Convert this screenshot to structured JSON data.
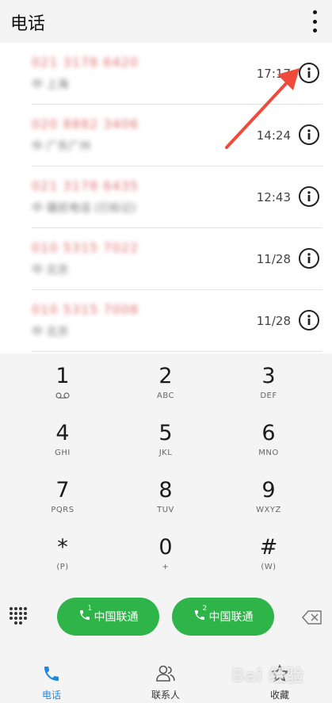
{
  "header": {
    "title": "电话",
    "more_icon": "more-vert-icon"
  },
  "calls": [
    {
      "number": "021 3178 6420",
      "location": "中 上海",
      "time": "17:17"
    },
    {
      "number": "020 8882 3406",
      "location": "中 广东广州",
      "time": "14:24"
    },
    {
      "number": "021 3178 6435",
      "location": "中 骚扰电话 (已标记)",
      "time": "12:43"
    },
    {
      "number": "010 5315 7022",
      "location": "中 北京",
      "time": "11/28"
    },
    {
      "number": "010 5315 7008",
      "location": "中 北京",
      "time": "11/28"
    }
  ],
  "keypad": [
    {
      "digit": "1",
      "letters": ""
    },
    {
      "digit": "2",
      "letters": "ABC"
    },
    {
      "digit": "3",
      "letters": "DEF"
    },
    {
      "digit": "4",
      "letters": "GHI"
    },
    {
      "digit": "5",
      "letters": "JKL"
    },
    {
      "digit": "6",
      "letters": "MNO"
    },
    {
      "digit": "7",
      "letters": "PQRS"
    },
    {
      "digit": "8",
      "letters": "TUV"
    },
    {
      "digit": "9",
      "letters": "WXYZ"
    },
    {
      "digit": "*",
      "letters": "(P)"
    },
    {
      "digit": "0",
      "letters": "+"
    },
    {
      "digit": "#",
      "letters": "(W)"
    }
  ],
  "actions": {
    "sim1": {
      "slot": "1",
      "label": "中国联通"
    },
    "sim2": {
      "slot": "2",
      "label": "中国联通"
    }
  },
  "nav": {
    "phone": "电话",
    "contacts": "联系人",
    "favorites": "收藏"
  },
  "watermark": "Bai 经验",
  "colors": {
    "accent": "#2fb44a",
    "nav_active": "#1e88e5",
    "number_red": "#e06d6d",
    "arrow": "#f04a3a"
  }
}
